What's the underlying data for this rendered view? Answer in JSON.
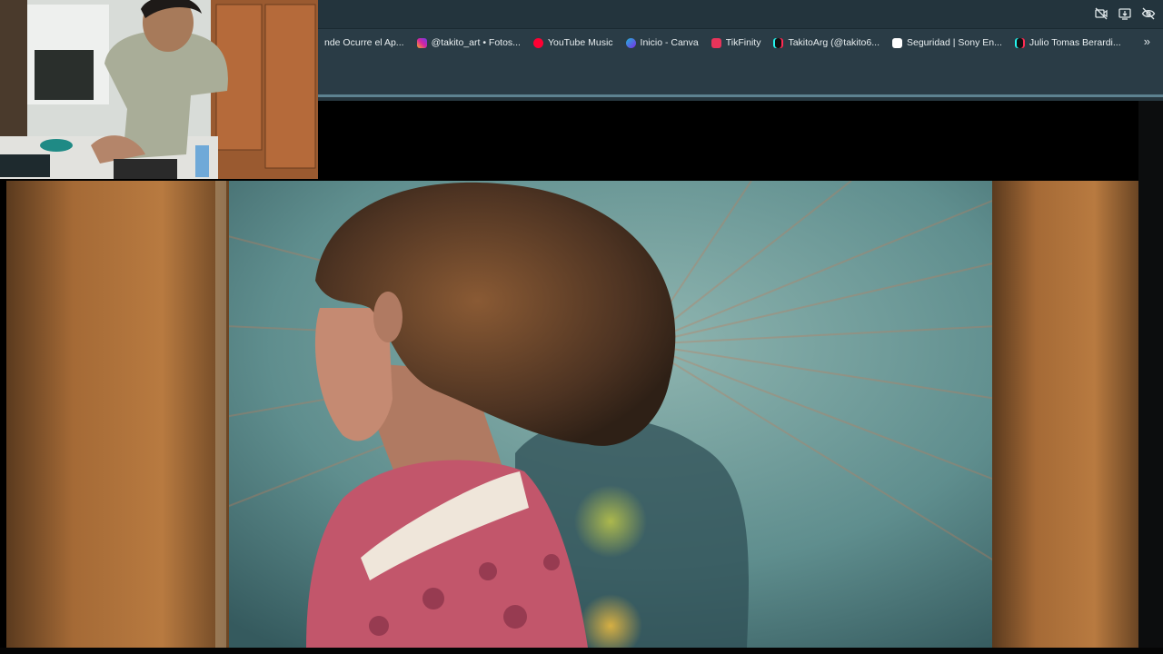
{
  "bookmarks": [
    {
      "label": "nde Ocurre el Ap...",
      "icon": "bookmark-icon",
      "color": "#2a3c46"
    },
    {
      "label": "@takito_art • Fotos...",
      "icon": "instagram-icon",
      "color": "#d6249f"
    },
    {
      "label": "YouTube Music",
      "icon": "youtube-music-icon",
      "color": "#ff0033"
    },
    {
      "label": "Inicio - Canva",
      "icon": "canva-icon",
      "color": "#1fb6d8"
    },
    {
      "label": "TikFinity",
      "icon": "tikfinity-icon",
      "color": "#e8345a"
    },
    {
      "label": "TakitoArg (@takito6...",
      "icon": "tiktok-icon",
      "color": "#111111"
    },
    {
      "label": "Seguridad | Sony En...",
      "icon": "sony-s-icon",
      "color": "#111111"
    },
    {
      "label": "Julio Tomas Berardi...",
      "icon": "tiktok-icon",
      "color": "#111111"
    }
  ],
  "more_label": "»",
  "top_icons": [
    "camera-off-icon",
    "install-app-icon",
    "eye-off-icon"
  ],
  "colors": {
    "accent": "#5d8290",
    "chrome": "#2a3c46"
  }
}
